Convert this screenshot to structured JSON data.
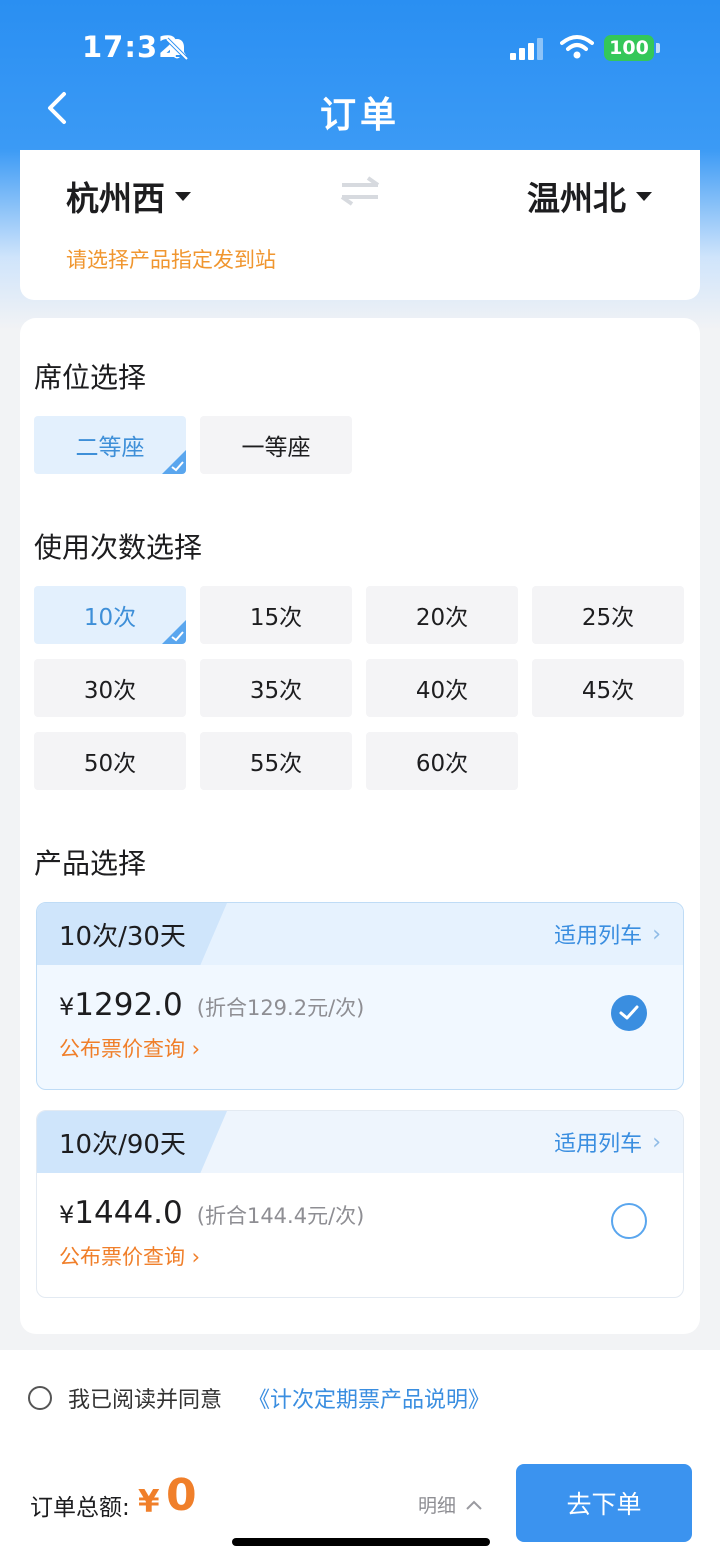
{
  "status_bar": {
    "time": "17:32",
    "battery": "100"
  },
  "header": {
    "title": "订单"
  },
  "stations": {
    "from": "杭州西",
    "to": "温州北",
    "hint": "请选择产品指定发到站"
  },
  "seat": {
    "title": "席位选择",
    "options": [
      {
        "label": "二等座",
        "selected": true
      },
      {
        "label": "一等座",
        "selected": false
      }
    ]
  },
  "count": {
    "title": "使用次数选择",
    "options": [
      {
        "label": "10次",
        "selected": true
      },
      {
        "label": "15次"
      },
      {
        "label": "20次"
      },
      {
        "label": "25次"
      },
      {
        "label": "30次"
      },
      {
        "label": "35次"
      },
      {
        "label": "40次"
      },
      {
        "label": "45次"
      },
      {
        "label": "50次"
      },
      {
        "label": "55次"
      },
      {
        "label": "60次"
      }
    ]
  },
  "product": {
    "title": "产品选择",
    "items": [
      {
        "tag": "10次/30天",
        "link": "适用列车",
        "currency": "¥",
        "price": "1292.0",
        "per": "(折合129.2元/次)",
        "query": "公布票价查询 ›",
        "selected": true
      },
      {
        "tag": "10次/90天",
        "link": "适用列车",
        "currency": "¥",
        "price": "1444.0",
        "per": "(折合144.4元/次)",
        "query": "公布票价查询 ›",
        "selected": false
      }
    ]
  },
  "agreement": {
    "text": "我已阅读并同意",
    "link": "《计次定期票产品说明》"
  },
  "footer": {
    "total_label": "订单总额:",
    "currency": "¥",
    "total": "0",
    "detail": "明细",
    "submit": "去下单"
  },
  "colors": {
    "primary": "#3b93ef",
    "accent_orange": "#f07f2a",
    "hint_orange": "#f0962f"
  }
}
